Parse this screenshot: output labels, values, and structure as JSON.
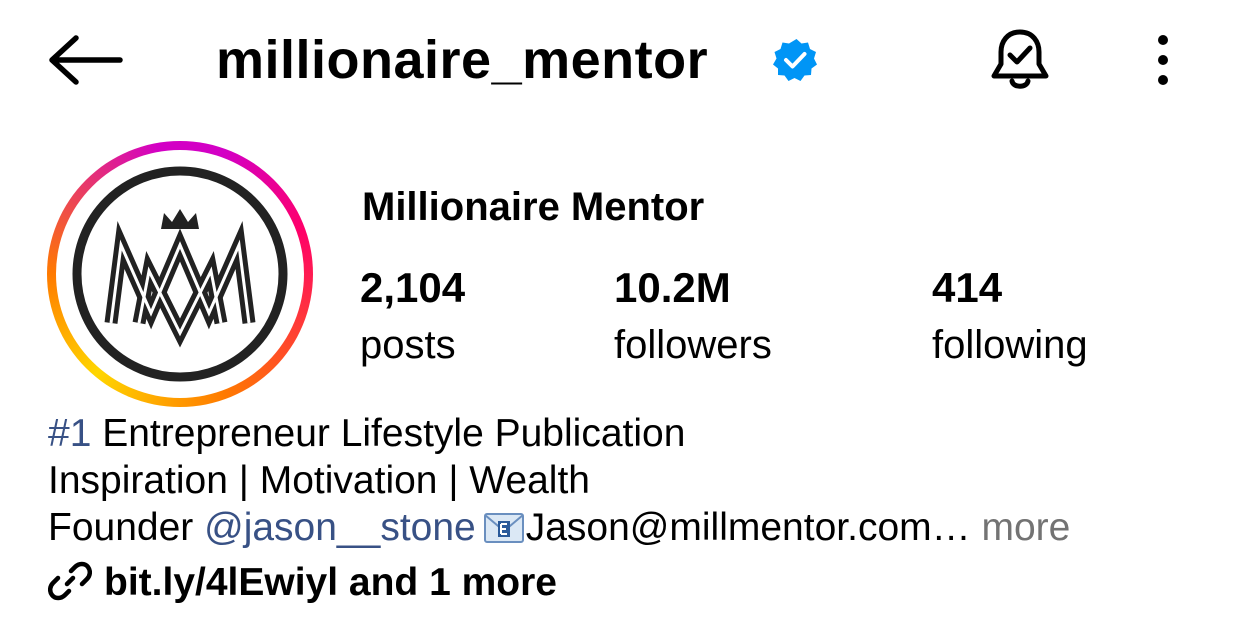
{
  "header": {
    "username": "millionaire_mentor",
    "verified_color": "#0095f6"
  },
  "profile": {
    "display_name": "Millionaire Mentor",
    "avatar_logo": "MM crown logo",
    "ring_colors": [
      "#d300c5",
      "#ff0069",
      "#ff7a00",
      "#ffd600"
    ]
  },
  "stats": {
    "posts": {
      "value": "2,104",
      "label": "posts"
    },
    "followers": {
      "value": "10.2M",
      "label": "followers"
    },
    "following": {
      "value": "414",
      "label": "following"
    }
  },
  "bio": {
    "line1_hashtag": "#1",
    "line1_text": " Entrepreneur Lifestyle Publication",
    "line2": "Inspiration | Motivation | Wealth",
    "line3_prefix": "Founder ",
    "line3_mention": "@jason__stone",
    "line3_email": "Jason@millmentor.com…",
    "line3_more": " more",
    "link_color": "#385185",
    "muted_color": "#737373"
  },
  "link": {
    "text": "bit.ly/4lEwiyl and 1 more"
  },
  "icons": {
    "back": "arrow-left-icon",
    "verified": "verified-badge-icon",
    "bell": "notification-bell-icon",
    "more": "more-vertical-icon",
    "email": "email-icon",
    "link": "link-icon"
  }
}
